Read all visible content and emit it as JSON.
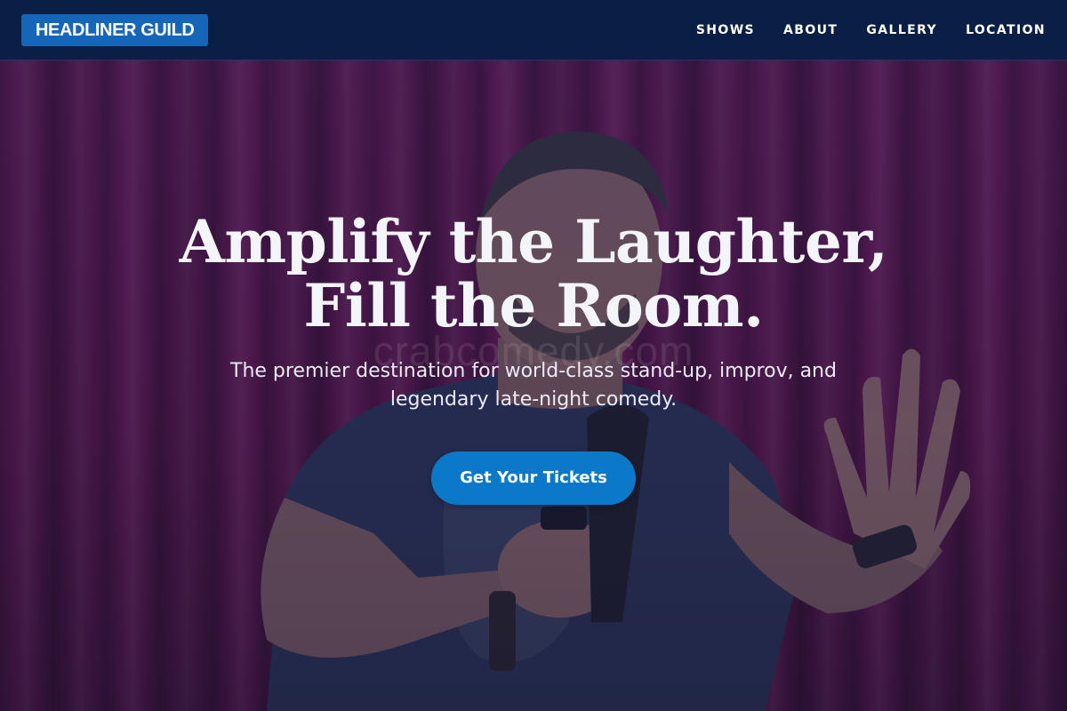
{
  "brand": {
    "name": "HEADLINER GUILD",
    "color": "#1565b8"
  },
  "nav": {
    "items": [
      {
        "label": "SHOWS"
      },
      {
        "label": "ABOUT"
      },
      {
        "label": "GALLERY"
      },
      {
        "label": "LOCATION"
      }
    ],
    "background": "#0b1f45"
  },
  "hero": {
    "headline": "Amplify the Laughter, Fill the Room.",
    "subheadline": "The premier destination for world-class stand-up, improv, and legendary late-night comedy.",
    "cta_label": "Get Your Tickets",
    "cta_color": "#0b78c8",
    "watermark": "crabcomedy.com",
    "background_image": "comedian-on-stage-with-microphone-red-curtain"
  }
}
